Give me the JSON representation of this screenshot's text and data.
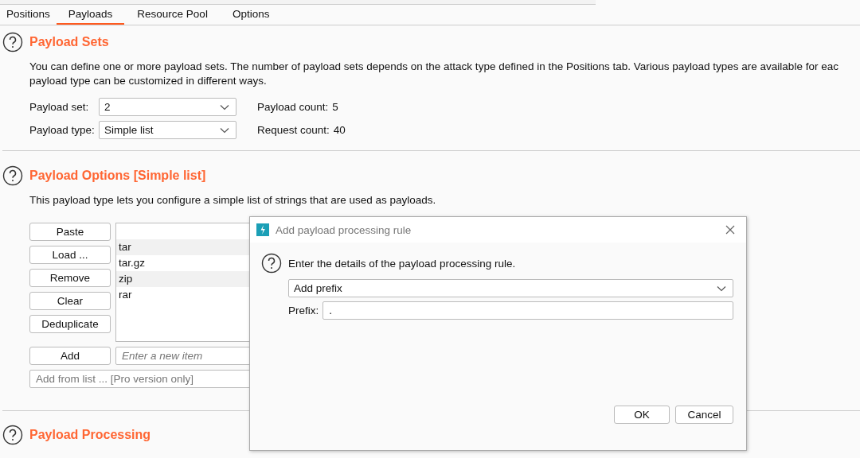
{
  "tabs": [
    {
      "label": "Positions",
      "selected": false
    },
    {
      "label": "Payloads",
      "selected": true
    },
    {
      "label": "Resource Pool",
      "selected": false
    },
    {
      "label": "Options",
      "selected": false
    }
  ],
  "payload_sets": {
    "title": "Payload Sets",
    "description_lines": [
      "You can define one or more payload sets. The number of payload sets depends on the attack type defined in the Positions tab. Various payload types are available for eac",
      "payload type can be customized in different ways."
    ],
    "set_label": "Payload set:",
    "set_value": "2",
    "type_label": "Payload type:",
    "type_value": "Simple list",
    "payload_count_label": "Payload count:",
    "payload_count_value": "5",
    "request_count_label": "Request count:",
    "request_count_value": "40"
  },
  "payload_options": {
    "title": "Payload Options [Simple list]",
    "description": "This payload type lets you configure a simple list of strings that are used as payloads.",
    "buttons": [
      "Paste",
      "Load ...",
      "Remove",
      "Clear",
      "Deduplicate"
    ],
    "items": [
      "tar",
      "tar.gz",
      "zip",
      "rar"
    ],
    "add_button": "Add",
    "new_item_placeholder": "Enter a new item",
    "add_from_list_placeholder": "Add from list ... [Pro version only]"
  },
  "payload_processing": {
    "title": "Payload Processing"
  },
  "dialog": {
    "title": "Add payload processing rule",
    "message": "Enter the details of the payload processing rule.",
    "rule_type": "Add prefix",
    "prefix_label": "Prefix:",
    "prefix_value": ".",
    "buttons": [
      "OK",
      "Cancel"
    ]
  }
}
